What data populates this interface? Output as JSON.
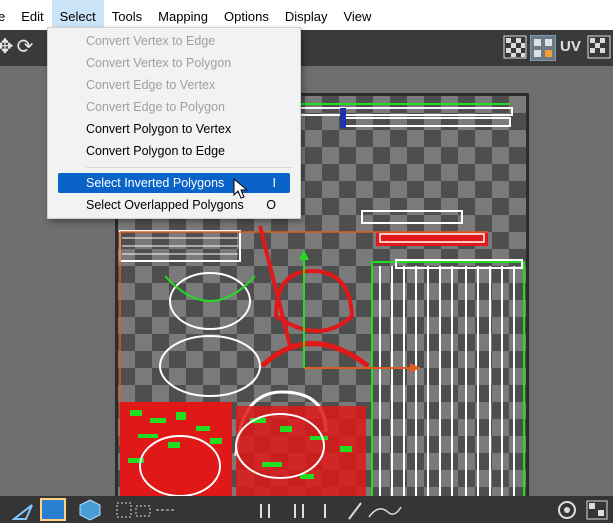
{
  "menubar": {
    "items": [
      "e",
      "Edit",
      "Select",
      "Tools",
      "Mapping",
      "Options",
      "Display",
      "View"
    ],
    "active": "Select"
  },
  "toolbar": {
    "uv_label": "UV"
  },
  "select_menu": {
    "items": [
      {
        "label": "Convert Vertex to Edge",
        "enabled": false,
        "shortcut": ""
      },
      {
        "label": "Convert Vertex to Polygon",
        "enabled": false,
        "shortcut": ""
      },
      {
        "label": "Convert Edge to Vertex",
        "enabled": false,
        "shortcut": ""
      },
      {
        "label": "Convert Edge to Polygon",
        "enabled": false,
        "shortcut": ""
      },
      {
        "label": "Convert Polygon to Vertex",
        "enabled": true,
        "shortcut": ""
      },
      {
        "label": "Convert Polygon to Edge",
        "enabled": true,
        "shortcut": ""
      },
      {
        "label": "Select Inverted Polygons",
        "enabled": true,
        "shortcut": "I",
        "highlighted": true
      },
      {
        "label": "Select Overlapped Polygons",
        "enabled": true,
        "shortcut": "O"
      }
    ]
  },
  "colors": {
    "menu_highlight": "#0a63c8",
    "uv_red": "#e01818",
    "uv_green": "#22dd22",
    "axis_orange": "#e35b1e"
  }
}
